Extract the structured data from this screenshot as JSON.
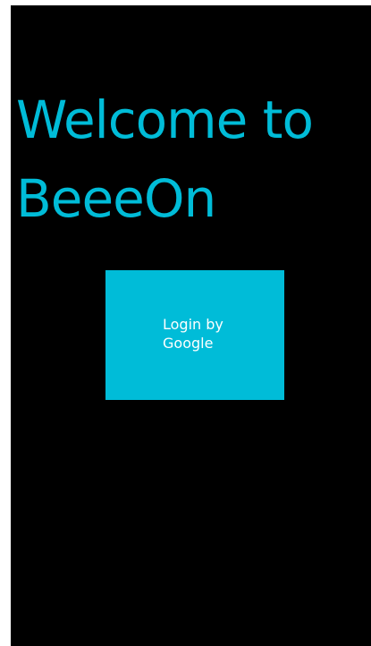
{
  "welcome": {
    "line1": "Welcome to",
    "line2": "BeeeOn"
  },
  "login_button": {
    "label": "Login by\nGoogle"
  },
  "colors": {
    "accent": "#00BCD8",
    "background": "#000000",
    "text_on_accent": "#FFFFFF"
  }
}
